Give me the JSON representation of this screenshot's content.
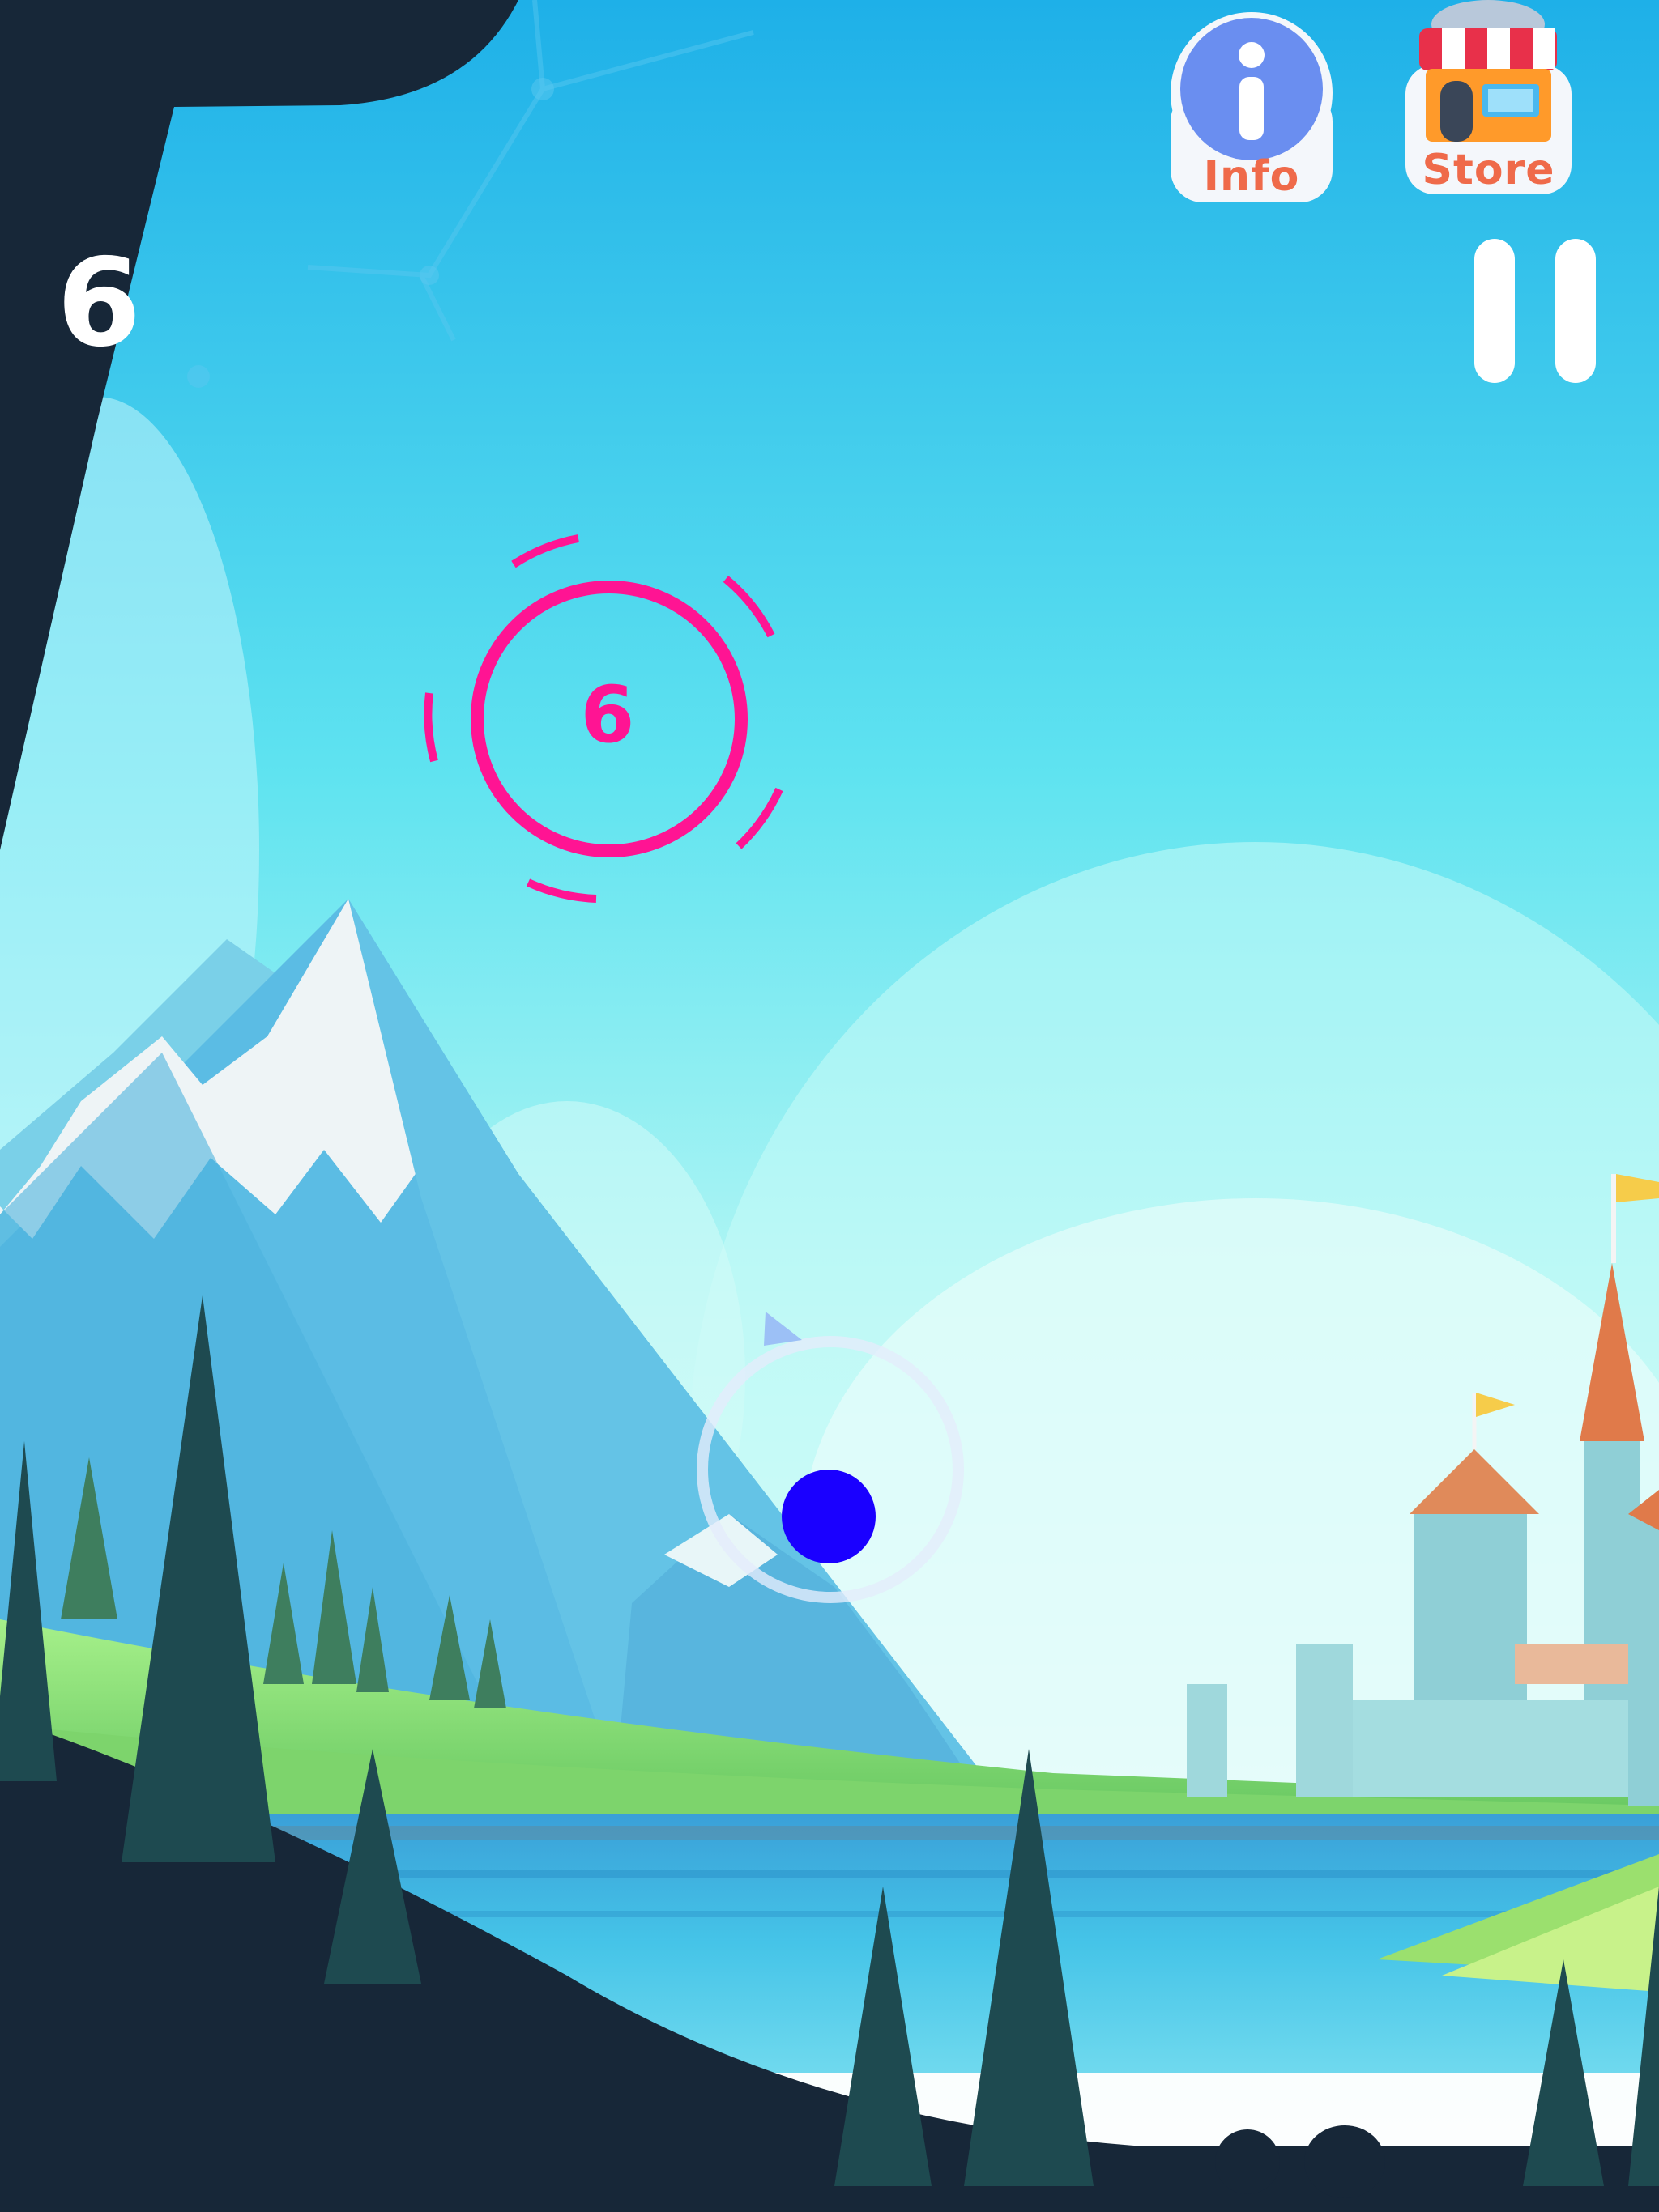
{
  "hud": {
    "score": "6",
    "info_label": "Info",
    "store_label": "Store"
  },
  "target": {
    "number": "6"
  },
  "colors": {
    "target_ring": "#ff1493",
    "player_ball": "#1a00ff",
    "label_orange": "#ef6a4a",
    "info_badge": "#6a8ef0",
    "sky_top": "#1fb2e8",
    "sky_bottom": "#e9fbfb",
    "dark_hill": "#162736"
  },
  "icons": {
    "info": "info-icon",
    "store": "store-icon",
    "pause": "pause-icon"
  }
}
